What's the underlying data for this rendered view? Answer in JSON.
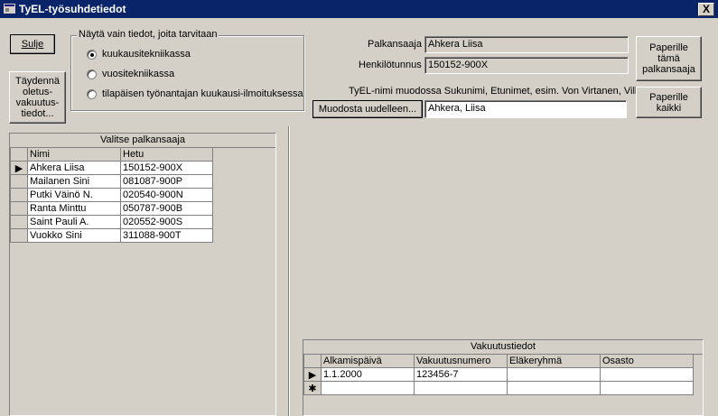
{
  "window": {
    "title": "TyEL-työsuhdetiedot",
    "close_label": "X"
  },
  "buttons": {
    "close": "Sulje",
    "fill_defaults": "Täydennä oletus-vakuutus-tiedot...",
    "paper_this": "Paperille tämä palkansaaja",
    "paper_all": "Paperille kaikki",
    "regenerate": "Muodosta uudelleen..."
  },
  "filter": {
    "legend": "Näytä vain tiedot, joita tarvitaan",
    "options": [
      {
        "label": "kuukausitekniikassa",
        "selected": true
      },
      {
        "label": "vuositekniikassa",
        "selected": false
      },
      {
        "label": "tilapäisen työnantajan kuukausi-ilmoituksessa",
        "selected": false
      }
    ]
  },
  "employee": {
    "name_label": "Palkansaaja",
    "name_value": "Ahkera Liisa",
    "id_label": "Henkilötunnus",
    "id_value": "150152-900X",
    "tyel_label": "TyEL-nimi muodossa Sukunimi, Etunimet, esim. Von Virtanen, Ville",
    "tyel_value": "Ahkera, Liisa"
  },
  "employees_grid": {
    "caption": "Valitse palkansaaja",
    "columns": [
      "Nimi",
      "Hetu"
    ],
    "rows": [
      {
        "name": "Ahkera Liisa",
        "hetu": "150152-900X",
        "current": true
      },
      {
        "name": "Mailanen Sini",
        "hetu": "081087-900P",
        "current": false
      },
      {
        "name": "Putki Väinö N.",
        "hetu": "020540-900N",
        "current": false
      },
      {
        "name": "Ranta Minttu",
        "hetu": "050787-900B",
        "current": false
      },
      {
        "name": "Saint Pauli A.",
        "hetu": "020552-900S",
        "current": false
      },
      {
        "name": "Vuokko Sini",
        "hetu": "311088-900T",
        "current": false
      }
    ]
  },
  "insurance_grid": {
    "caption": "Vakuutustiedot",
    "columns": [
      "Alkamispäivä",
      "Vakuutusnumero",
      "Eläkeryhmä",
      "Osasto"
    ],
    "rows": [
      {
        "start": "1.1.2000",
        "number": "123456-7",
        "group": "",
        "dept": ""
      }
    ],
    "new_row_marker": "✱"
  }
}
